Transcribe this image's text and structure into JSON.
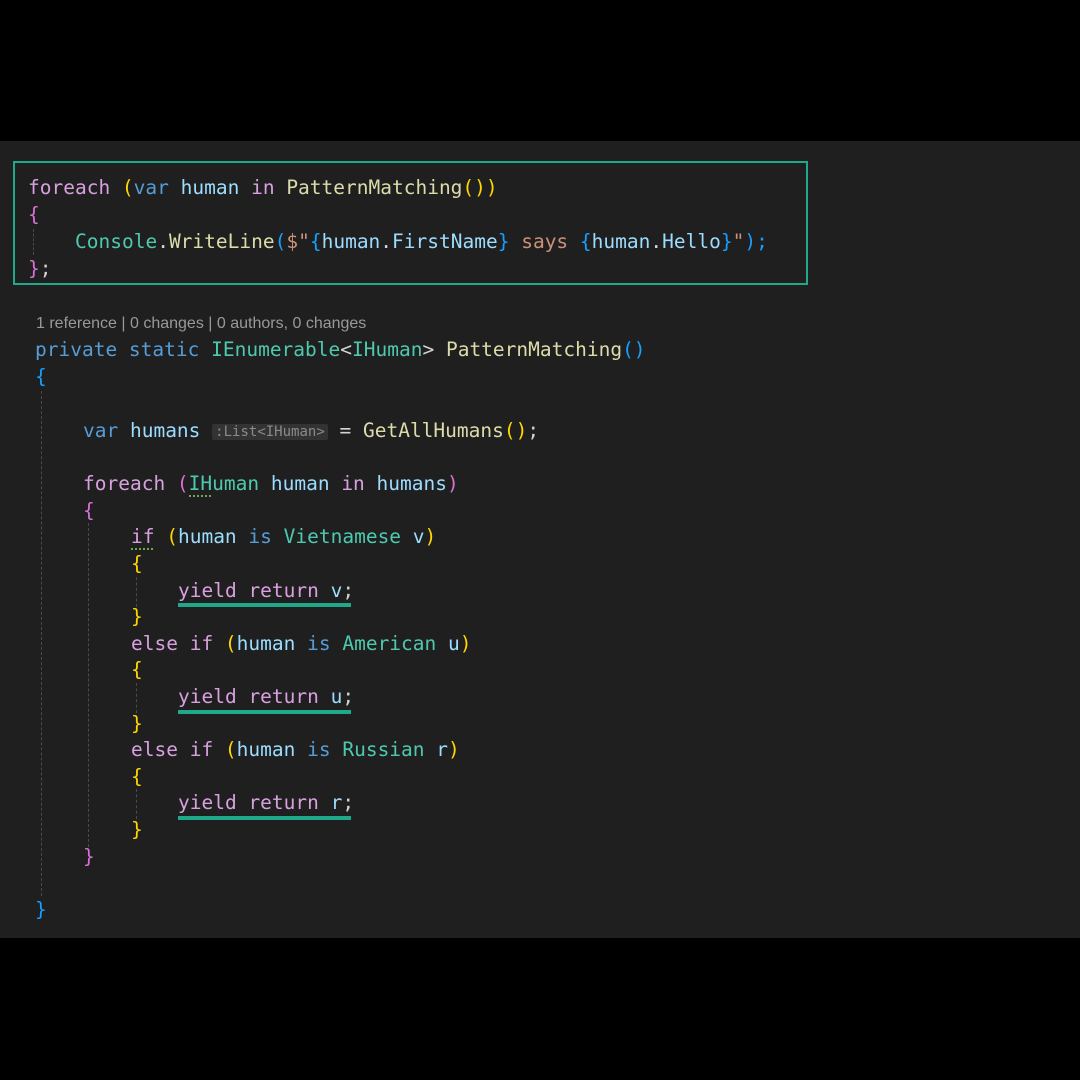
{
  "snippet_top": {
    "line1": {
      "kw1": "foreach",
      "p1": " (",
      "kw2": "var",
      "id1": " human ",
      "kw3": "in",
      "fn1": " PatternMatching",
      "p2": "())"
    },
    "line2": {
      "brace": "{"
    },
    "line3": {
      "ty": "Console",
      "dot": ".",
      "fn": "WriteLine",
      "p1": "(",
      "str1": "$\"",
      "b1": "{",
      "id1": "human",
      "dot2": ".",
      "id2": "FirstName",
      "b2": "}",
      "str2": " says ",
      "b3": "{",
      "id3": "human",
      "dot3": ".",
      "id4": "Hello",
      "b4": "}",
      "str3": "\"",
      "p2": ");"
    },
    "line4": {
      "brace": "}",
      "semi": ";"
    }
  },
  "codelens": "1 reference | 0 changes | 0 authors, 0 changes",
  "method": {
    "sig": {
      "kw1": "private",
      "kw2": " static",
      "ty1": " IEnumerable",
      "lt": "<",
      "ty2": "IHuman",
      "gt": ">",
      "fn": " PatternMatching",
      "p": "()"
    },
    "open": "{",
    "var_line": {
      "kw": "var",
      "id": " humans",
      "hint": ":List<IHuman>",
      "eq": " = ",
      "fn": "GetAllHumans",
      "p": "()",
      "semi": ";"
    },
    "foreach_line": {
      "kw": "foreach",
      "p1": " (",
      "ty": "IHuman",
      "id1": " human ",
      "kw2": "in",
      "id2": " humans",
      "p2": ")"
    },
    "foreach_open": "{",
    "if1": {
      "kw": "if",
      "p1": " (",
      "id1": "human",
      "kw2": " is",
      "ty": " Vietnamese",
      "id2": " v",
      "p2": ")"
    },
    "if1_open": "{",
    "yield1": {
      "kw1": "yield",
      "kw2": " return",
      "id": " v",
      "semi": ";"
    },
    "if1_close": "}",
    "if2": {
      "kw": "else if",
      "p1": " (",
      "id1": "human",
      "kw2": " is",
      "ty": " American",
      "id2": " u",
      "p2": ")"
    },
    "if2_open": "{",
    "yield2": {
      "kw1": "yield",
      "kw2": " return",
      "id": " u",
      "semi": ";"
    },
    "if2_close": "}",
    "if3": {
      "kw": "else if",
      "p1": " (",
      "id1": "human",
      "kw2": " is",
      "ty": " Russian",
      "id2": " r",
      "p2": ")"
    },
    "if3_open": "{",
    "yield3": {
      "kw1": "yield",
      "kw2": " return",
      "id": " r",
      "semi": ";"
    },
    "if3_close": "}",
    "foreach_close": "}",
    "close": "}"
  },
  "colors": {
    "background": "#1f1f1f",
    "frame": "#000000",
    "highlight": "#1fa88a"
  }
}
